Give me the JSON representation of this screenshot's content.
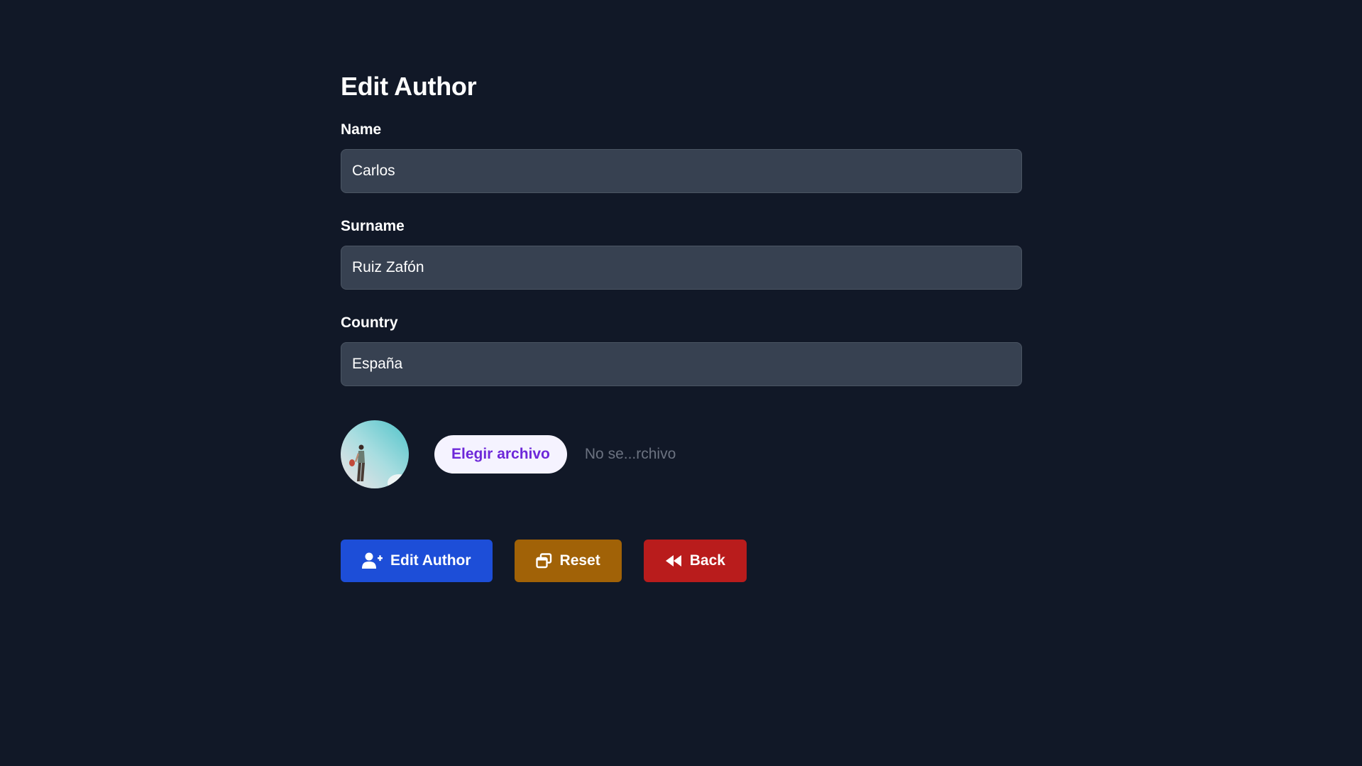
{
  "page": {
    "title": "Edit Author"
  },
  "form": {
    "name": {
      "label": "Name",
      "value": "Carlos"
    },
    "surname": {
      "label": "Surname",
      "value": "Ruiz Zafón"
    },
    "country": {
      "label": "Country",
      "value": "España"
    }
  },
  "upload": {
    "avatar_icon": "author-photo",
    "choose_label": "Elegir archivo",
    "status": "No se...rchivo"
  },
  "actions": {
    "submit_label": "Edit Author",
    "submit_icon": "user-plus-icon",
    "reset_label": "Reset",
    "reset_icon": "window-restore-icon",
    "back_label": "Back",
    "back_icon": "backward-icon"
  },
  "colors": {
    "background": "#111827",
    "input_bg": "#374151",
    "primary": "#1d4ed8",
    "warning": "#a16207",
    "danger": "#b91c1c",
    "file_button_bg": "#f5f3ff",
    "file_button_text": "#6d28d9"
  }
}
